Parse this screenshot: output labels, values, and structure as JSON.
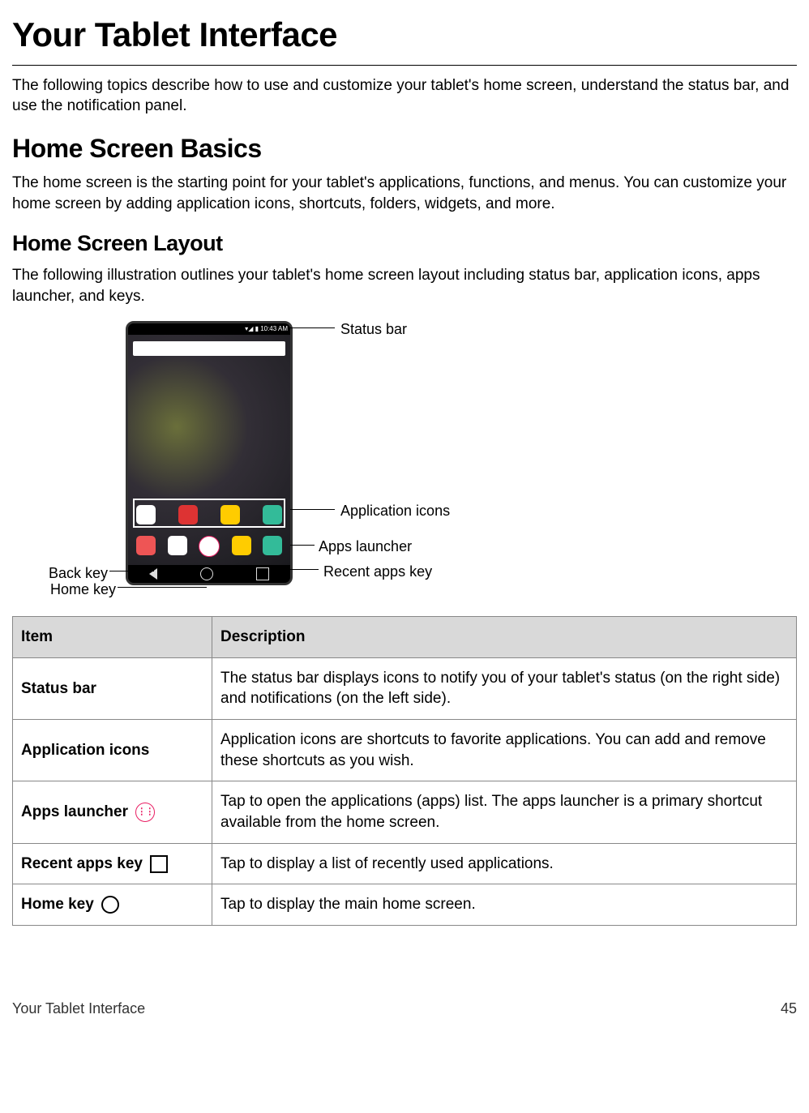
{
  "page_title": "Your Tablet Interface",
  "intro": "The following topics describe how to use and customize your tablet's home screen, understand the status bar, and use the notification panel.",
  "section_basics": {
    "heading": "Home Screen Basics",
    "body": "The home screen is the starting point for your tablet's applications, functions, and menus. You can customize your home screen by adding application icons, shortcuts, folders, widgets, and more."
  },
  "section_layout": {
    "heading": "Home Screen Layout",
    "body": "The following illustration outlines your tablet's home screen layout including status bar, application icons, apps launcher, and keys."
  },
  "illustration": {
    "callouts": {
      "status_bar": "Status bar",
      "application_icons": "Application icons",
      "apps_launcher": "Apps launcher",
      "recent_apps_key": "Recent apps key",
      "back_key": "Back key",
      "home_key": "Home key"
    },
    "status_time": "10:43 AM"
  },
  "table": {
    "headers": {
      "item": "Item",
      "description": "Description"
    },
    "rows": [
      {
        "item": "Status bar",
        "icon": null,
        "description": "The status bar displays icons to notify you of your tablet's status (on the right side) and notifications (on the left side)."
      },
      {
        "item": "Application icons",
        "icon": null,
        "description": "Application icons are shortcuts to favorite applications. You can add and remove these shortcuts as you wish."
      },
      {
        "item": "Apps launcher",
        "icon": "apps-launcher",
        "description": "Tap to open the applications (apps) list. The apps launcher is a primary shortcut available from the home screen."
      },
      {
        "item": "Recent apps key",
        "icon": "recent",
        "description": "Tap to display a list of recently used applications."
      },
      {
        "item": "Home key",
        "icon": "home",
        "description": "Tap to display the main home screen."
      }
    ]
  },
  "footer": {
    "title": "Your Tablet Interface",
    "page_number": "45"
  }
}
